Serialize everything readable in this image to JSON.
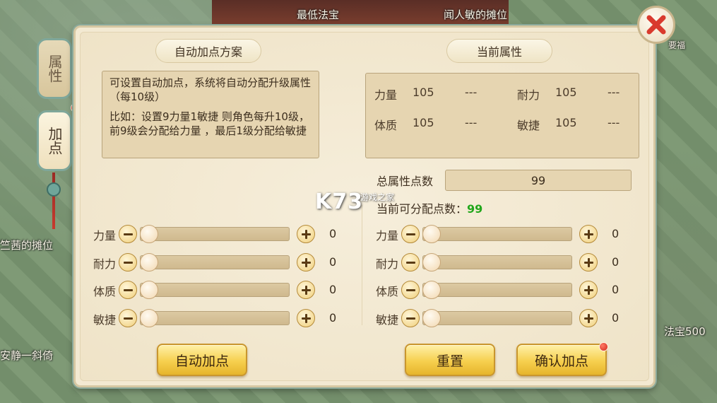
{
  "background": {
    "labels": [
      "最低法宝",
      "闻人敏的摊位",
      "竺茜的摊位",
      "法宝500",
      "安静一斜倚",
      "要福"
    ]
  },
  "side_tabs": [
    {
      "label": "属性",
      "active": false
    },
    {
      "label": "加点",
      "active": true
    }
  ],
  "left": {
    "header": "自动加点方案",
    "description": [
      "可设置自动加点，系统将自动分配升级属性（每10级）",
      "比如：设置9力量1敏捷 则角色每升10级，前9级会分配给力量 ，最后1级分配给敏捷"
    ],
    "sliders": [
      {
        "label": "力量",
        "value": "0"
      },
      {
        "label": "耐力",
        "value": "0"
      },
      {
        "label": "体质",
        "value": "0"
      },
      {
        "label": "敏捷",
        "value": "0"
      }
    ],
    "auto_button": "自动加点"
  },
  "right": {
    "header": "当前属性",
    "attributes": [
      {
        "name": "力量",
        "value": "105",
        "delta": "---"
      },
      {
        "name": "耐力",
        "value": "105",
        "delta": "---"
      },
      {
        "name": "体质",
        "value": "105",
        "delta": "---"
      },
      {
        "name": "敏捷",
        "value": "105",
        "delta": "---"
      }
    ],
    "total_label": "总属性点数",
    "total_value": "99",
    "available_label": "当前可分配点数：",
    "available_value": "99",
    "sliders": [
      {
        "label": "力量",
        "value": "0"
      },
      {
        "label": "耐力",
        "value": "0"
      },
      {
        "label": "体质",
        "value": "0"
      },
      {
        "label": "敏捷",
        "value": "0"
      }
    ],
    "reset_button": "重置",
    "confirm_button": "确认加点"
  },
  "watermark": {
    "main": "K73",
    "sub": "游戏之家"
  },
  "colors": {
    "available": "#22a71c",
    "close": "#d93a2e",
    "button": "#f6cf4e"
  },
  "icons": {
    "close": "close-x-icon",
    "minus": "minus-icon",
    "plus": "plus-icon"
  }
}
